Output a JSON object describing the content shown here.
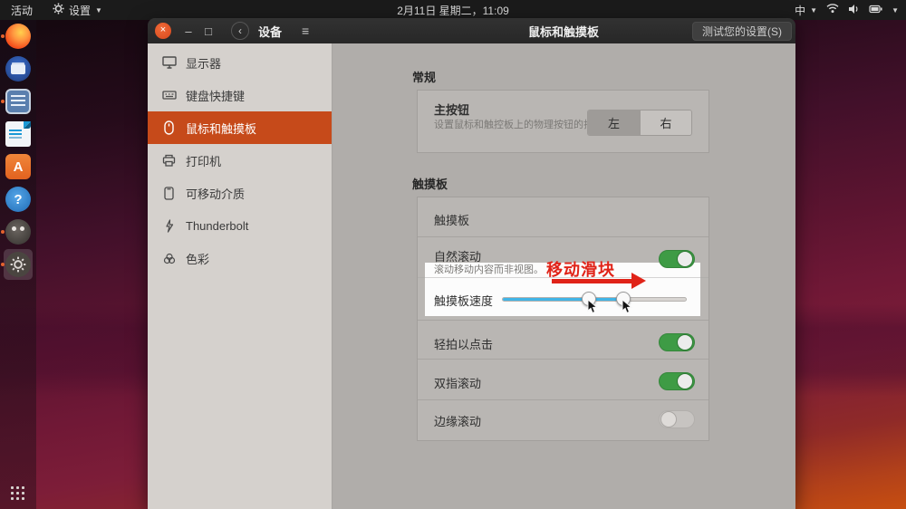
{
  "topbar": {
    "activities": "活动",
    "app_name": "设置",
    "clock": "2月11日 星期二，11:09",
    "input_method": "中"
  },
  "dock": {
    "apps": [
      "firefox",
      "files",
      "text-editor",
      "libreoffice-writer",
      "ubuntu-software",
      "help",
      "gimp",
      "settings"
    ],
    "software_letter": "A",
    "help_mark": "?"
  },
  "window": {
    "header": {
      "close": "×",
      "minimize": "–",
      "maximize": "□",
      "back": "‹",
      "menu": "≡",
      "title": "设备",
      "page_title": "鼠标和触摸板",
      "test_button": "测试您的设置(S)"
    },
    "sidebar": {
      "items": [
        {
          "label": "显示器",
          "icon": "monitor"
        },
        {
          "label": "键盘快捷键",
          "icon": "keyboard"
        },
        {
          "label": "鼠标和触摸板",
          "icon": "mouse"
        },
        {
          "label": "打印机",
          "icon": "printer"
        },
        {
          "label": "可移动介质",
          "icon": "removable-media"
        },
        {
          "label": "Thunderbolt",
          "icon": "thunderbolt"
        },
        {
          "label": "色彩",
          "icon": "color"
        }
      ],
      "selected_index": 2
    },
    "content": {
      "general_heading": "常规",
      "primary_button": {
        "label": "主按钮",
        "description": "设置鼠标和触控板上的物理按钮的排列。",
        "option_left": "左",
        "option_right": "右",
        "selected": "左"
      },
      "touchpad_heading": "触摸板",
      "touchpad": {
        "panel_label": "触摸板",
        "natural_scroll": {
          "label": "自然滚动",
          "description": "滚动移动内容而非视图。",
          "state": "on"
        },
        "speed": {
          "label": "触摸板速度",
          "fill_percent": 66,
          "handle1_percent": 47,
          "handle2_percent": 66
        },
        "tap_to_click": {
          "label": "轻拍以点击",
          "state": "on"
        },
        "two_finger_scroll": {
          "label": "双指滚动",
          "state": "on"
        },
        "edge_scroll": {
          "label": "边缘滚动",
          "state": "off"
        }
      }
    }
  },
  "annotation": {
    "text": "移动滑块",
    "color": "#e02318"
  },
  "colors": {
    "accent_orange": "#c64a1a",
    "close_button": "#e95420",
    "toggle_on_green": "#3e9b45",
    "slider_blue": "#41b4e6",
    "highlight_white": "#fcfcfc"
  }
}
